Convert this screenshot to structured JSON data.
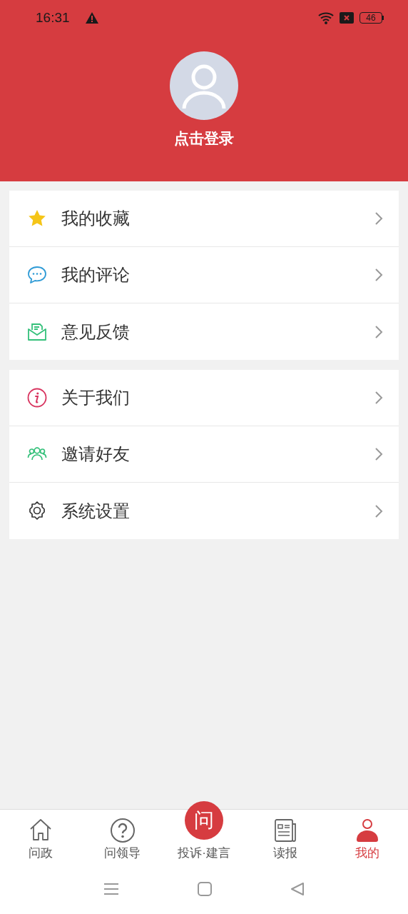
{
  "status_bar": {
    "time": "16:31",
    "battery": "46"
  },
  "profile": {
    "login_label": "点击登录"
  },
  "menu_groups": [
    {
      "items": [
        {
          "kind": "star",
          "label": "我的收藏"
        },
        {
          "kind": "comment",
          "label": "我的评论"
        },
        {
          "kind": "mail",
          "label": "意见反馈"
        }
      ]
    },
    {
      "items": [
        {
          "kind": "info",
          "label": "关于我们"
        },
        {
          "kind": "friends",
          "label": "邀请好友"
        },
        {
          "kind": "gear",
          "label": "系统设置"
        }
      ]
    }
  ],
  "bottom_nav": [
    {
      "kind": "home",
      "label": "问政",
      "selected": false
    },
    {
      "kind": "question",
      "label": "问领导",
      "selected": false
    },
    {
      "kind": "center",
      "badge": "问",
      "label": "投诉·建言",
      "selected": false
    },
    {
      "kind": "news",
      "label": "读报",
      "selected": false
    },
    {
      "kind": "user",
      "label": "我的",
      "selected": true
    }
  ]
}
